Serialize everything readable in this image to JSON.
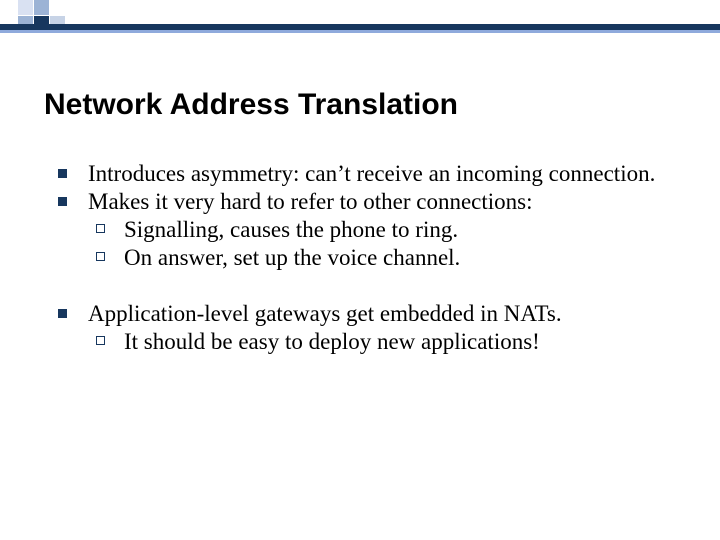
{
  "title": "Network Address Translation",
  "bullets": {
    "b1": "Introduces asymmetry: can’t receive an incoming connection.",
    "b2": "Makes it very hard to refer to other connections:",
    "b2s1": "Signalling, causes the phone to ring.",
    "b2s2": "On answer, set up the voice channel.",
    "b3": "Application-level gateways get embedded in NATs.",
    "b3s1": "It should be easy to deploy new applications!"
  }
}
